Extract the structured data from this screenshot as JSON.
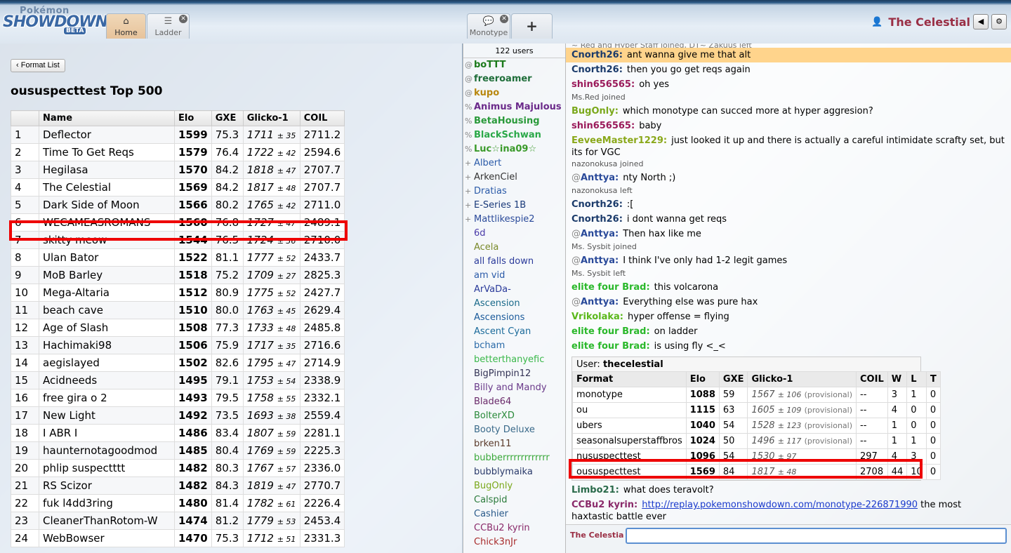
{
  "header": {
    "logo_top": "Pokémon",
    "logo_main": "SHOWDOWN!",
    "logo_badge": "BETA",
    "tabs": [
      {
        "label": "Home",
        "icon": "home-icon"
      },
      {
        "label": "Ladder",
        "icon": "list-icon"
      }
    ],
    "room_tabs": [
      {
        "label": "Monotype",
        "icon": "speech-bubble-icon"
      }
    ],
    "add_tab": "+",
    "username": "The Celestial"
  },
  "left": {
    "format_button": "Format List",
    "title": "oususpecttest Top 500",
    "columns": [
      "",
      "Name",
      "Elo",
      "GXE",
      "Glicko-1",
      "COIL"
    ],
    "highlighted_rank": 4,
    "rows": [
      {
        "rank": "1",
        "name": "Deflector",
        "elo": "1599",
        "gxe": "75.3",
        "glicko": "1711",
        "dev": "± 35",
        "coil": "2711.2"
      },
      {
        "rank": "2",
        "name": "Time To Get Reqs",
        "elo": "1579",
        "gxe": "76.4",
        "glicko": "1722",
        "dev": "± 42",
        "coil": "2594.6"
      },
      {
        "rank": "3",
        "name": "Hegilasa",
        "elo": "1570",
        "gxe": "84.2",
        "glicko": "1818",
        "dev": "± 47",
        "coil": "2707.7"
      },
      {
        "rank": "4",
        "name": "The Celestial",
        "elo": "1569",
        "gxe": "84.2",
        "glicko": "1817",
        "dev": "± 48",
        "coil": "2707.7"
      },
      {
        "rank": "5",
        "name": "Dark Side of Moon",
        "elo": "1566",
        "gxe": "80.2",
        "glicko": "1765",
        "dev": "± 42",
        "coil": "2711.0"
      },
      {
        "rank": "6",
        "name": "WECAMEASROMANS",
        "elo": "1560",
        "gxe": "76.8",
        "glicko": "1727",
        "dev": "± 47",
        "coil": "2489.1"
      },
      {
        "rank": "7",
        "name": "skitty meow",
        "elo": "1544",
        "gxe": "76.5",
        "glicko": "1724",
        "dev": "± 36",
        "coil": "2710.0"
      },
      {
        "rank": "8",
        "name": "Ulan Bator",
        "elo": "1522",
        "gxe": "81.1",
        "glicko": "1777",
        "dev": "± 52",
        "coil": "2433.7"
      },
      {
        "rank": "9",
        "name": "MoB Barley",
        "elo": "1518",
        "gxe": "75.2",
        "glicko": "1709",
        "dev": "± 27",
        "coil": "2825.3"
      },
      {
        "rank": "10",
        "name": "Mega-Altaria",
        "elo": "1512",
        "gxe": "80.9",
        "glicko": "1775",
        "dev": "± 52",
        "coil": "2427.7"
      },
      {
        "rank": "11",
        "name": "beach cave",
        "elo": "1510",
        "gxe": "80.0",
        "glicko": "1763",
        "dev": "± 45",
        "coil": "2629.4"
      },
      {
        "rank": "12",
        "name": "Age of Slash",
        "elo": "1508",
        "gxe": "77.3",
        "glicko": "1733",
        "dev": "± 48",
        "coil": "2485.8"
      },
      {
        "rank": "13",
        "name": "Hachimaki98",
        "elo": "1506",
        "gxe": "75.9",
        "glicko": "1717",
        "dev": "± 35",
        "coil": "2716.6"
      },
      {
        "rank": "14",
        "name": "aegislayed",
        "elo": "1502",
        "gxe": "82.6",
        "glicko": "1795",
        "dev": "± 47",
        "coil": "2714.9"
      },
      {
        "rank": "15",
        "name": "Acidneeds",
        "elo": "1495",
        "gxe": "79.1",
        "glicko": "1753",
        "dev": "± 54",
        "coil": "2338.9"
      },
      {
        "rank": "16",
        "name": "free gira o 2",
        "elo": "1493",
        "gxe": "79.5",
        "glicko": "1758",
        "dev": "± 55",
        "coil": "2332.1"
      },
      {
        "rank": "17",
        "name": "New Light",
        "elo": "1492",
        "gxe": "73.5",
        "glicko": "1693",
        "dev": "± 38",
        "coil": "2559.4"
      },
      {
        "rank": "18",
        "name": "I ABR I",
        "elo": "1486",
        "gxe": "83.4",
        "glicko": "1807",
        "dev": "± 59",
        "coil": "2281.1"
      },
      {
        "rank": "19",
        "name": "haunternotagoodmod",
        "elo": "1485",
        "gxe": "80.4",
        "glicko": "1769",
        "dev": "± 59",
        "coil": "2225.3"
      },
      {
        "rank": "20",
        "name": "phlip suspectttt",
        "elo": "1482",
        "gxe": "80.3",
        "glicko": "1767",
        "dev": "± 57",
        "coil": "2336.0"
      },
      {
        "rank": "21",
        "name": "RS Scizor",
        "elo": "1482",
        "gxe": "84.3",
        "glicko": "1819",
        "dev": "± 47",
        "coil": "2770.7"
      },
      {
        "rank": "22",
        "name": "fuk l4dd3ring",
        "elo": "1480",
        "gxe": "81.4",
        "glicko": "1782",
        "dev": "± 61",
        "coil": "2226.4"
      },
      {
        "rank": "23",
        "name": "CleanerThanRotom-W",
        "elo": "1474",
        "gxe": "81.2",
        "glicko": "1779",
        "dev": "± 53",
        "coil": "2453.4"
      },
      {
        "rank": "24",
        "name": "WebBowser",
        "elo": "1470",
        "gxe": "75.3",
        "glicko": "1712",
        "dev": "± 51",
        "coil": "2331.3"
      }
    ]
  },
  "userlist": {
    "count": "122 users",
    "users": [
      {
        "g": "@",
        "name": "boTTT",
        "color": "#1b7a1b",
        "bold": true
      },
      {
        "g": "@",
        "name": "freeroamer",
        "color": "#1f6e3a",
        "bold": true
      },
      {
        "g": "@",
        "name": "kupo",
        "color": "#b8870f",
        "bold": true
      },
      {
        "g": "%",
        "name": "Animus Majulous",
        "color": "#6b2a8a",
        "bold": true
      },
      {
        "g": "%",
        "name": "BetaHousing",
        "color": "#2a9a3a",
        "bold": true
      },
      {
        "g": "%",
        "name": "BlackSchwan",
        "color": "#2aa848",
        "bold": true
      },
      {
        "g": "%",
        "name": "Luc☆ina09☆",
        "color": "#3a9a2a",
        "bold": true
      },
      {
        "g": "+",
        "name": "Albert",
        "color": "#2a5aa8",
        "bold": false
      },
      {
        "g": "+",
        "name": "ArkenCiel",
        "color": "#333333",
        "bold": false
      },
      {
        "g": "+",
        "name": "Dratias",
        "color": "#2a5aa8",
        "bold": false
      },
      {
        "g": "+",
        "name": "E-Series 1B",
        "color": "#1a3a7a",
        "bold": false
      },
      {
        "g": "+",
        "name": "Mattlikespie2",
        "color": "#2a4a9a",
        "bold": false
      },
      {
        "g": "",
        "name": "6d",
        "color": "#4a3aa8",
        "bold": false
      },
      {
        "g": "",
        "name": "Acela",
        "color": "#7a8a2a",
        "bold": false
      },
      {
        "g": "",
        "name": "all falls down",
        "color": "#2a3a9a",
        "bold": false
      },
      {
        "g": "",
        "name": "am vid",
        "color": "#2a5aa8",
        "bold": false
      },
      {
        "g": "",
        "name": "ArVaDa-",
        "color": "#2a3a9a",
        "bold": false
      },
      {
        "g": "",
        "name": "Ascension",
        "color": "#1a6a8a",
        "bold": false
      },
      {
        "g": "",
        "name": "Ascensions",
        "color": "#1a5a9a",
        "bold": false
      },
      {
        "g": "",
        "name": "Ascent Cyan",
        "color": "#1a6a9a",
        "bold": false
      },
      {
        "g": "",
        "name": "bcham",
        "color": "#2a6aa8",
        "bold": false
      },
      {
        "g": "",
        "name": "betterthanyefic",
        "color": "#3ab84a",
        "bold": false
      },
      {
        "g": "",
        "name": "BigPimpin12",
        "color": "#333355",
        "bold": false
      },
      {
        "g": "",
        "name": "Billy and Mandy",
        "color": "#6a3a8a",
        "bold": false
      },
      {
        "g": "",
        "name": "Blade64",
        "color": "#6a2a6a",
        "bold": false
      },
      {
        "g": "",
        "name": "BolterXD",
        "color": "#2a8a3a",
        "bold": false
      },
      {
        "g": "",
        "name": "Booty Deluxe",
        "color": "#3a6a8a",
        "bold": false
      },
      {
        "g": "",
        "name": "brken11",
        "color": "#5a3a2a",
        "bold": false
      },
      {
        "g": "",
        "name": "bubberrrrrrrrrrrrr",
        "color": "#3aa83a",
        "bold": false
      },
      {
        "g": "",
        "name": "bubblymaika",
        "color": "#2a3a6a",
        "bold": false
      },
      {
        "g": "",
        "name": "BugOnly",
        "color": "#7aa81a",
        "bold": false
      },
      {
        "g": "",
        "name": "Calspid",
        "color": "#2a7a3a",
        "bold": false
      },
      {
        "g": "",
        "name": "Cashier",
        "color": "#2a5a8a",
        "bold": false
      },
      {
        "g": "",
        "name": "CCBu2 kyrin",
        "color": "#8a2a6a",
        "bold": false
      },
      {
        "g": "",
        "name": "Chick3nJr",
        "color": "#a82a2a",
        "bold": false
      }
    ]
  },
  "chat": {
    "cutoff": "~ Red and Hyper Staff joined, DT~ Zakuus left",
    "log": [
      {
        "kind": "msg",
        "user": "Cnorth26:",
        "color": "#1a3a6a",
        "text": "ant wanna give me that alt",
        "hl": true
      },
      {
        "kind": "msg",
        "user": "Cnorth26:",
        "color": "#1a3a6a",
        "text": "then you go get reqs again"
      },
      {
        "kind": "msg",
        "user": "shin656565:",
        "color": "#9a1a5a",
        "text": "oh yes"
      },
      {
        "kind": "notice",
        "text": "Ms.Red joined"
      },
      {
        "kind": "msg",
        "user": "BugOnly:",
        "color": "#7aa81a",
        "text": "which monotype can succed more at hyper aggresion?"
      },
      {
        "kind": "msg",
        "user": "shin656565:",
        "color": "#9a1a5a",
        "text": "baby"
      },
      {
        "kind": "msg",
        "user": "EeveeMaster1229:",
        "color": "#8aa81a",
        "text": "just looked it up and there is actually a careful intimidate scrafty set, but its for VGC"
      },
      {
        "kind": "notice",
        "text": "nazonokusa joined"
      },
      {
        "kind": "msg",
        "prefix": "@",
        "user": "Anttya:",
        "color": "#2a4a9a",
        "text": "nty North ;)"
      },
      {
        "kind": "notice",
        "text": "nazonokusa left"
      },
      {
        "kind": "msg",
        "user": "Cnorth26:",
        "color": "#1a3a6a",
        "text": ":["
      },
      {
        "kind": "msg",
        "user": "Cnorth26:",
        "color": "#1a3a6a",
        "text": "i dont wanna get reqs"
      },
      {
        "kind": "msg",
        "prefix": "@",
        "user": "Anttya:",
        "color": "#2a4a9a",
        "text": "Then hax like me"
      },
      {
        "kind": "notice",
        "text": "Ms. Sysbit joined"
      },
      {
        "kind": "msg",
        "prefix": "@",
        "user": "Anttya:",
        "color": "#2a4a9a",
        "text": "I think I've only had 1-2 legit games"
      },
      {
        "kind": "notice",
        "text": "Ms. Sysbit left"
      },
      {
        "kind": "msg",
        "user": "elite four Brad:",
        "color": "#2ab82a",
        "text": "this volcarona"
      },
      {
        "kind": "msg",
        "prefix": "@",
        "user": "Anttya:",
        "color": "#2a4a9a",
        "text": "Everything else was pure hax"
      },
      {
        "kind": "msg",
        "user": "Vrikolaka:",
        "color": "#5ab81a",
        "text": "hyper offense = flying"
      },
      {
        "kind": "msg",
        "user": "elite four Brad:",
        "color": "#2ab82a",
        "text": "on ladder"
      },
      {
        "kind": "msg",
        "user": "elite four Brad:",
        "color": "#2ab82a",
        "text": "is using fly <_<"
      }
    ],
    "infobox": {
      "user_label": "User:",
      "user": "thecelestial",
      "columns": [
        "Format",
        "Elo",
        "GXE",
        "Glicko-1",
        "COIL",
        "W",
        "L",
        "T"
      ],
      "rows": [
        {
          "format": "monotype",
          "elo": "1088",
          "gxe": "59",
          "glicko": "1567",
          "dev": "± 106",
          "prov": "(provisional)",
          "coil": "--",
          "w": "3",
          "l": "1",
          "t": "0"
        },
        {
          "format": "ou",
          "elo": "1115",
          "gxe": "63",
          "glicko": "1605",
          "dev": "± 109",
          "prov": "(provisional)",
          "coil": "--",
          "w": "4",
          "l": "0",
          "t": "0"
        },
        {
          "format": "ubers",
          "elo": "1040",
          "gxe": "54",
          "glicko": "1528",
          "dev": "± 123",
          "prov": "(provisional)",
          "coil": "--",
          "w": "1",
          "l": "0",
          "t": "0"
        },
        {
          "format": "seasonalsuperstaffbros",
          "elo": "1024",
          "gxe": "50",
          "glicko": "1496",
          "dev": "± 117",
          "prov": "(provisional)",
          "coil": "--",
          "w": "1",
          "l": "1",
          "t": "0"
        },
        {
          "format": "nususpecttest",
          "elo": "1096",
          "gxe": "54",
          "glicko": "1530",
          "dev": "± 97",
          "prov": "",
          "coil": "297",
          "w": "4",
          "l": "3",
          "t": "0"
        },
        {
          "format": "oususpecttest",
          "elo": "1569",
          "gxe": "84",
          "glicko": "1817",
          "dev": "± 48",
          "prov": "",
          "coil": "2708",
          "w": "44",
          "l": "10",
          "t": "0"
        }
      ]
    },
    "after": [
      {
        "kind": "msg",
        "user": "Limbo21:",
        "color": "#2a6a4a",
        "text": "what does teravolt?"
      },
      {
        "kind": "msg",
        "user": "CCBu2 kyrin:",
        "color": "#8a2a6a",
        "link": "http://replay.pokemonshowdown.com/monotype-226871990",
        "text": "the most haxtastic battle ever"
      }
    ]
  },
  "chatbox": {
    "name": "The Celestia",
    "value": ""
  },
  "colors": {
    "highlight_box": "#ee0000",
    "username": "#9a2f45",
    "chat_highlight": "#ffd48c"
  }
}
